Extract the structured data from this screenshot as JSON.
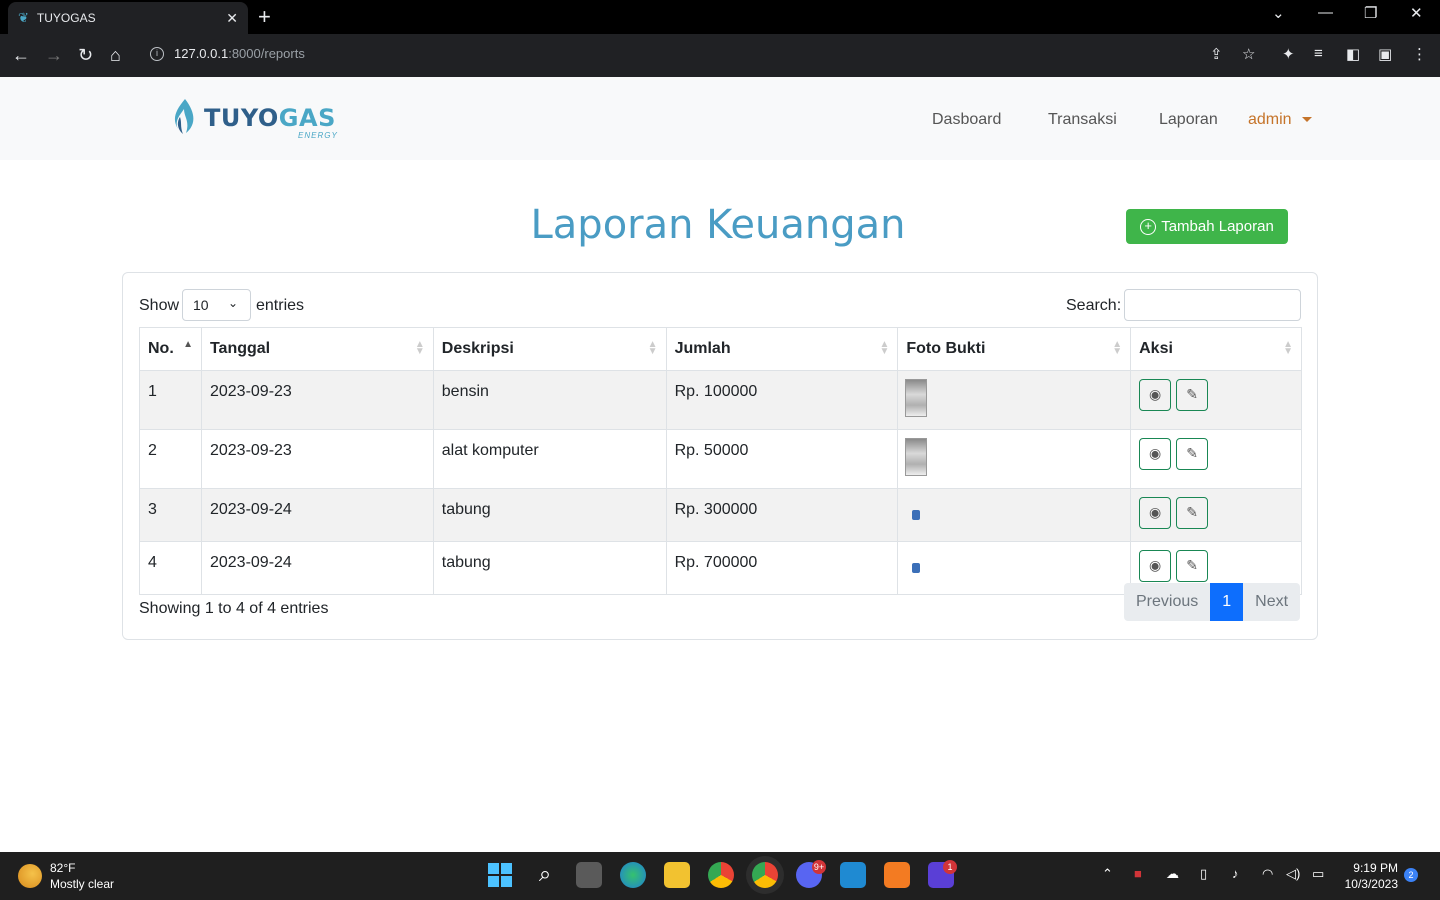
{
  "browser": {
    "tab_title": "TUYOGAS",
    "tab_close": "✕",
    "new_tab": "+",
    "url_host": "127.0.0.1",
    "url_path": ":8000/reports"
  },
  "nav": {
    "brand_main_dark": "TUYO",
    "brand_main_light": "GAS",
    "brand_sub": "ENERGY",
    "items": [
      "Dasboard",
      "Transaksi",
      "Laporan"
    ],
    "user": "admin"
  },
  "page": {
    "title": "Laporan Keuangan",
    "add_button": "Tambah Laporan"
  },
  "table_controls": {
    "show_label": "Show",
    "length_value": "10",
    "entries_label": "entries",
    "search_label": "Search:",
    "search_value": ""
  },
  "table": {
    "headers": [
      "No.",
      "Tanggal",
      "Deskripsi",
      "Jumlah",
      "Foto Bukti",
      "Aksi"
    ],
    "rows": [
      {
        "no": "1",
        "tanggal": "2023-09-23",
        "deskripsi": "bensin",
        "jumlah": "Rp. 100000"
      },
      {
        "no": "2",
        "tanggal": "2023-09-23",
        "deskripsi": "alat komputer",
        "jumlah": "Rp. 50000"
      },
      {
        "no": "3",
        "tanggal": "2023-09-24",
        "deskripsi": "tabung",
        "jumlah": "Rp. 300000"
      },
      {
        "no": "4",
        "tanggal": "2023-09-24",
        "deskripsi": "tabung",
        "jumlah": "Rp. 700000"
      }
    ]
  },
  "footer": {
    "info": "Showing 1 to 4 of 4 entries",
    "prev": "Previous",
    "page": "1",
    "next": "Next"
  },
  "taskbar": {
    "temp": "82°F",
    "condition": "Mostly clear",
    "time": "9:19 PM",
    "date": "10/3/2023",
    "discord_badge": "9+",
    "app_badge": "1",
    "notif_count": "2"
  },
  "colors": {
    "accent_title": "#4a9cc4",
    "add_button": "#3fb54a",
    "admin": "#c5742a",
    "page_active": "#0d6efd"
  }
}
